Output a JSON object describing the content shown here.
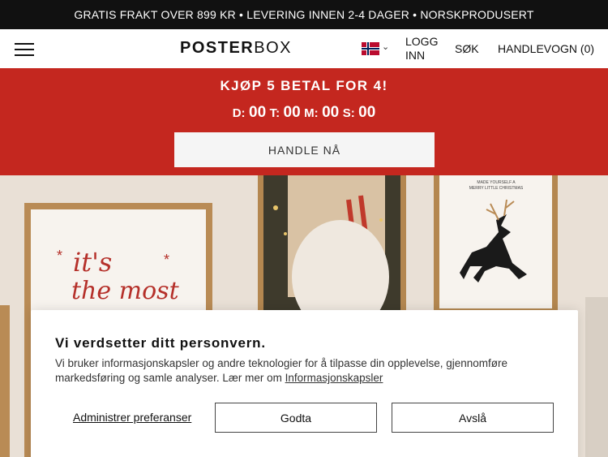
{
  "topbar": {
    "text": "GRATIS FRAKT OVER 899 KR • LEVERING INNEN 2-4 DAGER • NORSKPRODUSERT"
  },
  "header": {
    "logo_bold": "POSTER",
    "logo_light": "BOX",
    "login_line1": "LOGG",
    "login_line2": "INN",
    "search": "SØK",
    "cart": "HANDLEVOGN (0)",
    "flag_icon": "norway-flag-icon"
  },
  "promo": {
    "title": "KJØP 5 BETAL FOR 4!",
    "countdown": {
      "d_label": "D:",
      "d_value": "00",
      "t_label": "T:",
      "t_value": "00",
      "m_label": "M:",
      "m_value": "00",
      "s_label": "S:",
      "s_value": "00"
    },
    "button": "HANDLE NÅ",
    "bg_color": "#c4271f"
  },
  "hero": {
    "poster_script_line1": "it's",
    "poster_script_line2": "the most",
    "poster_small_line1": "MADE YOURSELF A",
    "poster_small_line2": "MERRY LITTLE CHRISTMAS"
  },
  "cookie": {
    "title": "Vi verdsetter ditt personvern.",
    "text": "Vi bruker informasjonskapsler og andre teknologier for å tilpasse din opplevelse, gjennomføre markedsføring og samle analyser. Lær mer om",
    "link": "Informasjonskapsler",
    "preferences": "Administrer preferanser",
    "accept": "Godta",
    "reject": "Avslå"
  }
}
